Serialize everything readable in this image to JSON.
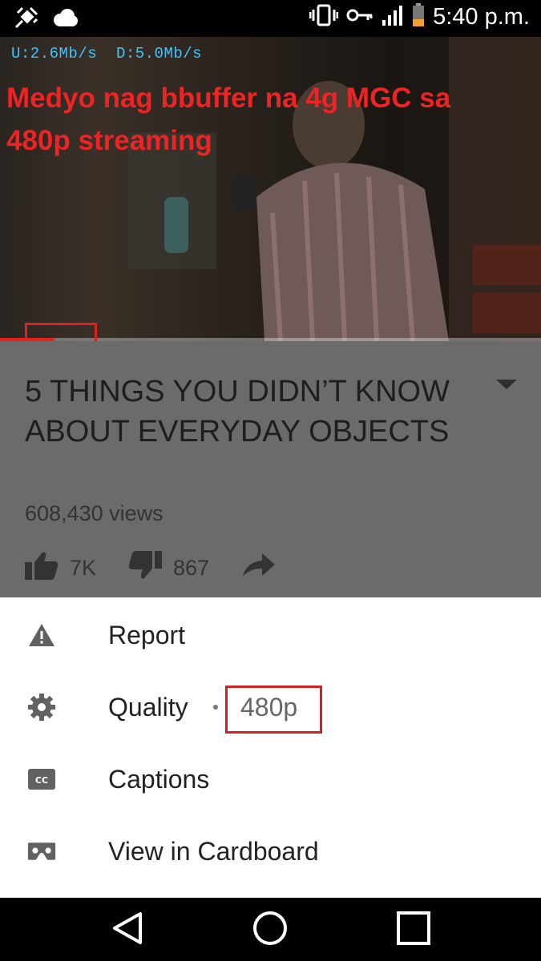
{
  "status_bar": {
    "time": "5:40 p.m.",
    "icons": [
      "satellite-icon",
      "cloud-icon",
      "vibrate-icon",
      "vpn-key-icon",
      "signal-icon",
      "battery-icon"
    ]
  },
  "video": {
    "speed_upload": "U:2.6Mb/s",
    "speed_download": "D:5.0Mb/s",
    "overlay_caption": "Medyo nag bbuffer na 4g MGC sa 480p streaming",
    "progress": 0.1,
    "progress_color": "#e62117"
  },
  "info": {
    "title": "5 THINGS YOU DIDN’T KNOW ABOUT EVERYDAY OBJECTS",
    "views": "608,430 views",
    "likes": "7K",
    "dislikes": "867"
  },
  "menu": {
    "report_label": "Report",
    "quality_label": "Quality",
    "quality_value": "480p",
    "captions_label": "Captions",
    "cardboard_label": "View in Cardboard"
  },
  "colors": {
    "annotation_red": "#e02020",
    "overlay_caption": "#ee2323",
    "speed_text": "#40c4ff"
  }
}
